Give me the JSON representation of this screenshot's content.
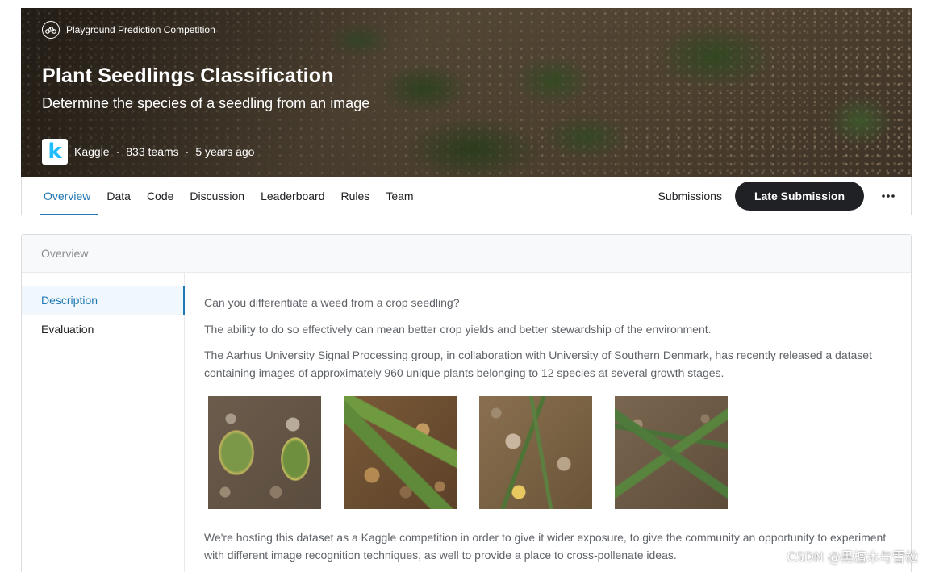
{
  "hero": {
    "tag": "Playground Prediction Competition",
    "title": "Plant Seedlings Classification",
    "subtitle": "Determine the species of a seedling from an image",
    "host": "Kaggle",
    "teams": "833 teams",
    "age": "5 years ago",
    "logo_letter": "k",
    "separator": "·"
  },
  "tabs": [
    {
      "label": "Overview",
      "active": true
    },
    {
      "label": "Data"
    },
    {
      "label": "Code"
    },
    {
      "label": "Discussion"
    },
    {
      "label": "Leaderboard"
    },
    {
      "label": "Rules"
    },
    {
      "label": "Team"
    }
  ],
  "actions": {
    "submissions": "Submissions",
    "late_submission": "Late Submission",
    "more_icon": "more-horizontal-icon"
  },
  "overview": {
    "header": "Overview",
    "sidenav": [
      {
        "label": "Description",
        "active": true
      },
      {
        "label": "Evaluation"
      }
    ],
    "paragraphs": [
      "Can you differentiate a weed from a crop seedling?",
      "The ability to do so effectively can mean better crop yields and better stewardship of the environment.",
      "The Aarhus University Signal Processing group, in collaboration with University of Southern Denmark, has recently released a dataset containing images of approximately 960 unique plants belonging to 12 species at several growth stages.",
      "We're hosting this dataset as a Kaggle competition in order to give it wider exposure, to give the community an opportunity to experiment with different image recognition techniques, as well to provide a place to cross-pollenate ideas."
    ]
  },
  "watermark": "CSDN @黑檀木与雪松",
  "colors": {
    "accent": "#1f78b4",
    "button_bg": "#202124",
    "kaggle_blue": "#20beff"
  }
}
